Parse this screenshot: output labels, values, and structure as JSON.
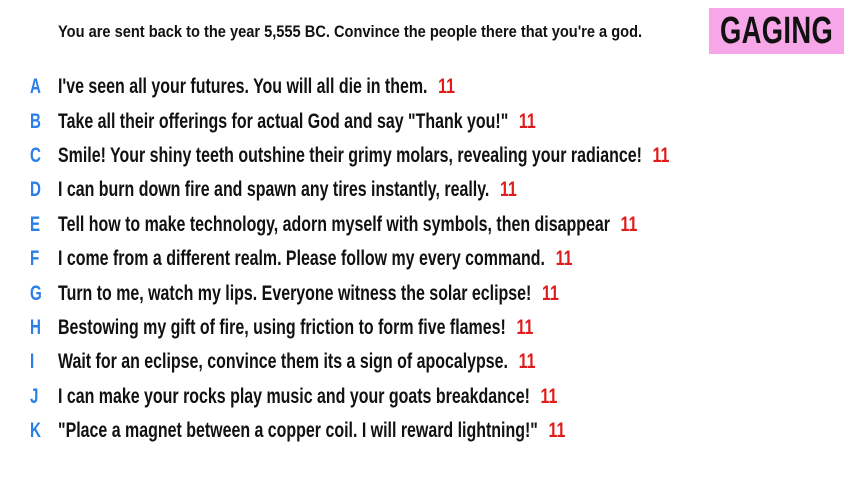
{
  "prompt": "You are sent back to the year 5,555 BC. Convince the people there that you're a god.",
  "badge": {
    "label": "GAGING",
    "color": "#f7a6e8"
  },
  "colors": {
    "letter": "#2a7ee6",
    "score": "#e01b1b",
    "text": "#111111"
  },
  "options": [
    {
      "letter": "A",
      "text": "I've seen all your futures. You will all die in them.",
      "score": "11"
    },
    {
      "letter": "B",
      "text": "Take all their offerings for actual God and say \"Thank you!\"",
      "score": "11"
    },
    {
      "letter": "C",
      "text": "Smile! Your shiny teeth outshine their grimy molars, revealing your radiance!",
      "score": "11"
    },
    {
      "letter": "D",
      "text": "I can burn down fire and spawn any tires instantly, really.",
      "score": "11"
    },
    {
      "letter": "E",
      "text": "Tell how to make technology, adorn myself with symbols, then disappear",
      "score": "11"
    },
    {
      "letter": "F",
      "text": "I come from a different realm. Please follow my every command.",
      "score": "11"
    },
    {
      "letter": "G",
      "text": "Turn to me, watch my lips. Everyone witness the solar eclipse!",
      "score": "11"
    },
    {
      "letter": "H",
      "text": "Bestowing my gift of fire, using friction to form five flames!",
      "score": "11"
    },
    {
      "letter": "I",
      "text": "Wait for an eclipse, convince them its a sign of apocalypse.",
      "score": "11"
    },
    {
      "letter": "J",
      "text": "I can make your rocks play music and your goats breakdance!",
      "score": "11"
    },
    {
      "letter": "K",
      "text": "\"Place a magnet between a copper coil. I will reward lightning!\"",
      "score": "11"
    }
  ]
}
